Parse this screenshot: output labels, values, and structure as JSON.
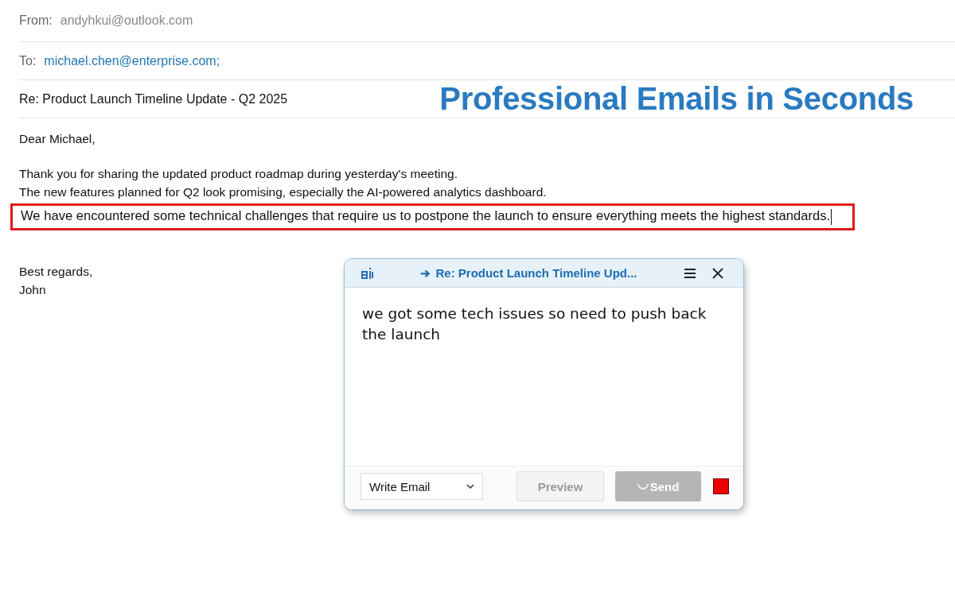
{
  "email": {
    "from_label": "From:",
    "from": "andyhkui@outlook.com",
    "to_label": "To:",
    "to": "michael.chen@enterprise.com;",
    "subject": "Re: Product Launch Timeline Update - Q2 2025",
    "banner": "Professional Emails in Seconds",
    "greeting": "Dear Michael,",
    "body": [
      {
        "text": "Thank you for sharing the updated product roadmap during yesterday's meeting.",
        "highlighted": false
      },
      {
        "text": "The new features planned for Q2 look promising, especially the AI-powered analytics dashboard.",
        "highlighted": false
      },
      {
        "text": "We have encountered some technical challenges that require us to postpone the launch to ensure everything meets the highest standards.",
        "highlighted": true
      }
    ],
    "closing": [
      "Best regards,",
      "John"
    ]
  },
  "assistant": {
    "arrow": "➔",
    "title": "Re: Product Launch Timeline Upd...",
    "input": "we got some tech issues so need to push back the launch",
    "mode": "Write Email",
    "preview": {
      "label": "Preview",
      "disabled": true
    },
    "send": {
      "label": "Send",
      "loading": true
    }
  }
}
